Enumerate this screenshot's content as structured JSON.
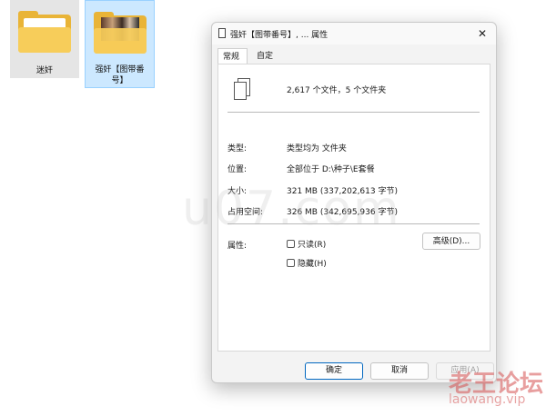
{
  "desktop": {
    "items": [
      {
        "label": "迷奸"
      },
      {
        "label_line1": "强奸【图带番",
        "label_line2": "号】"
      }
    ]
  },
  "window": {
    "title": "强奸【图带番号】, ... 属性",
    "close_glyph": "✕",
    "tabs": [
      {
        "label": "常规",
        "active": true
      },
      {
        "label": "自定义",
        "active": false
      }
    ],
    "summary": "2,617 个文件，5 个文件夹",
    "rows": {
      "type": {
        "label": "类型:",
        "value": "类型均为 文件夹"
      },
      "location": {
        "label": "位置:",
        "value": "全部位于 D:\\种子\\E套餐"
      },
      "size": {
        "label": "大小:",
        "value": "321 MB (337,202,613 字节)"
      },
      "disk": {
        "label": "占用空间:",
        "value": "326 MB (342,695,936 字节)"
      }
    },
    "attributes": {
      "label": "属性:",
      "readonly": "只读(R)",
      "hidden": "隐藏(H)",
      "advanced_button": "高级(D)..."
    },
    "buttons": {
      "ok": "确定",
      "cancel": "取消",
      "apply": "应用(A)"
    }
  },
  "watermarks": {
    "center": "u07.com",
    "brand": "老王论坛",
    "url": "laowang.vip"
  }
}
